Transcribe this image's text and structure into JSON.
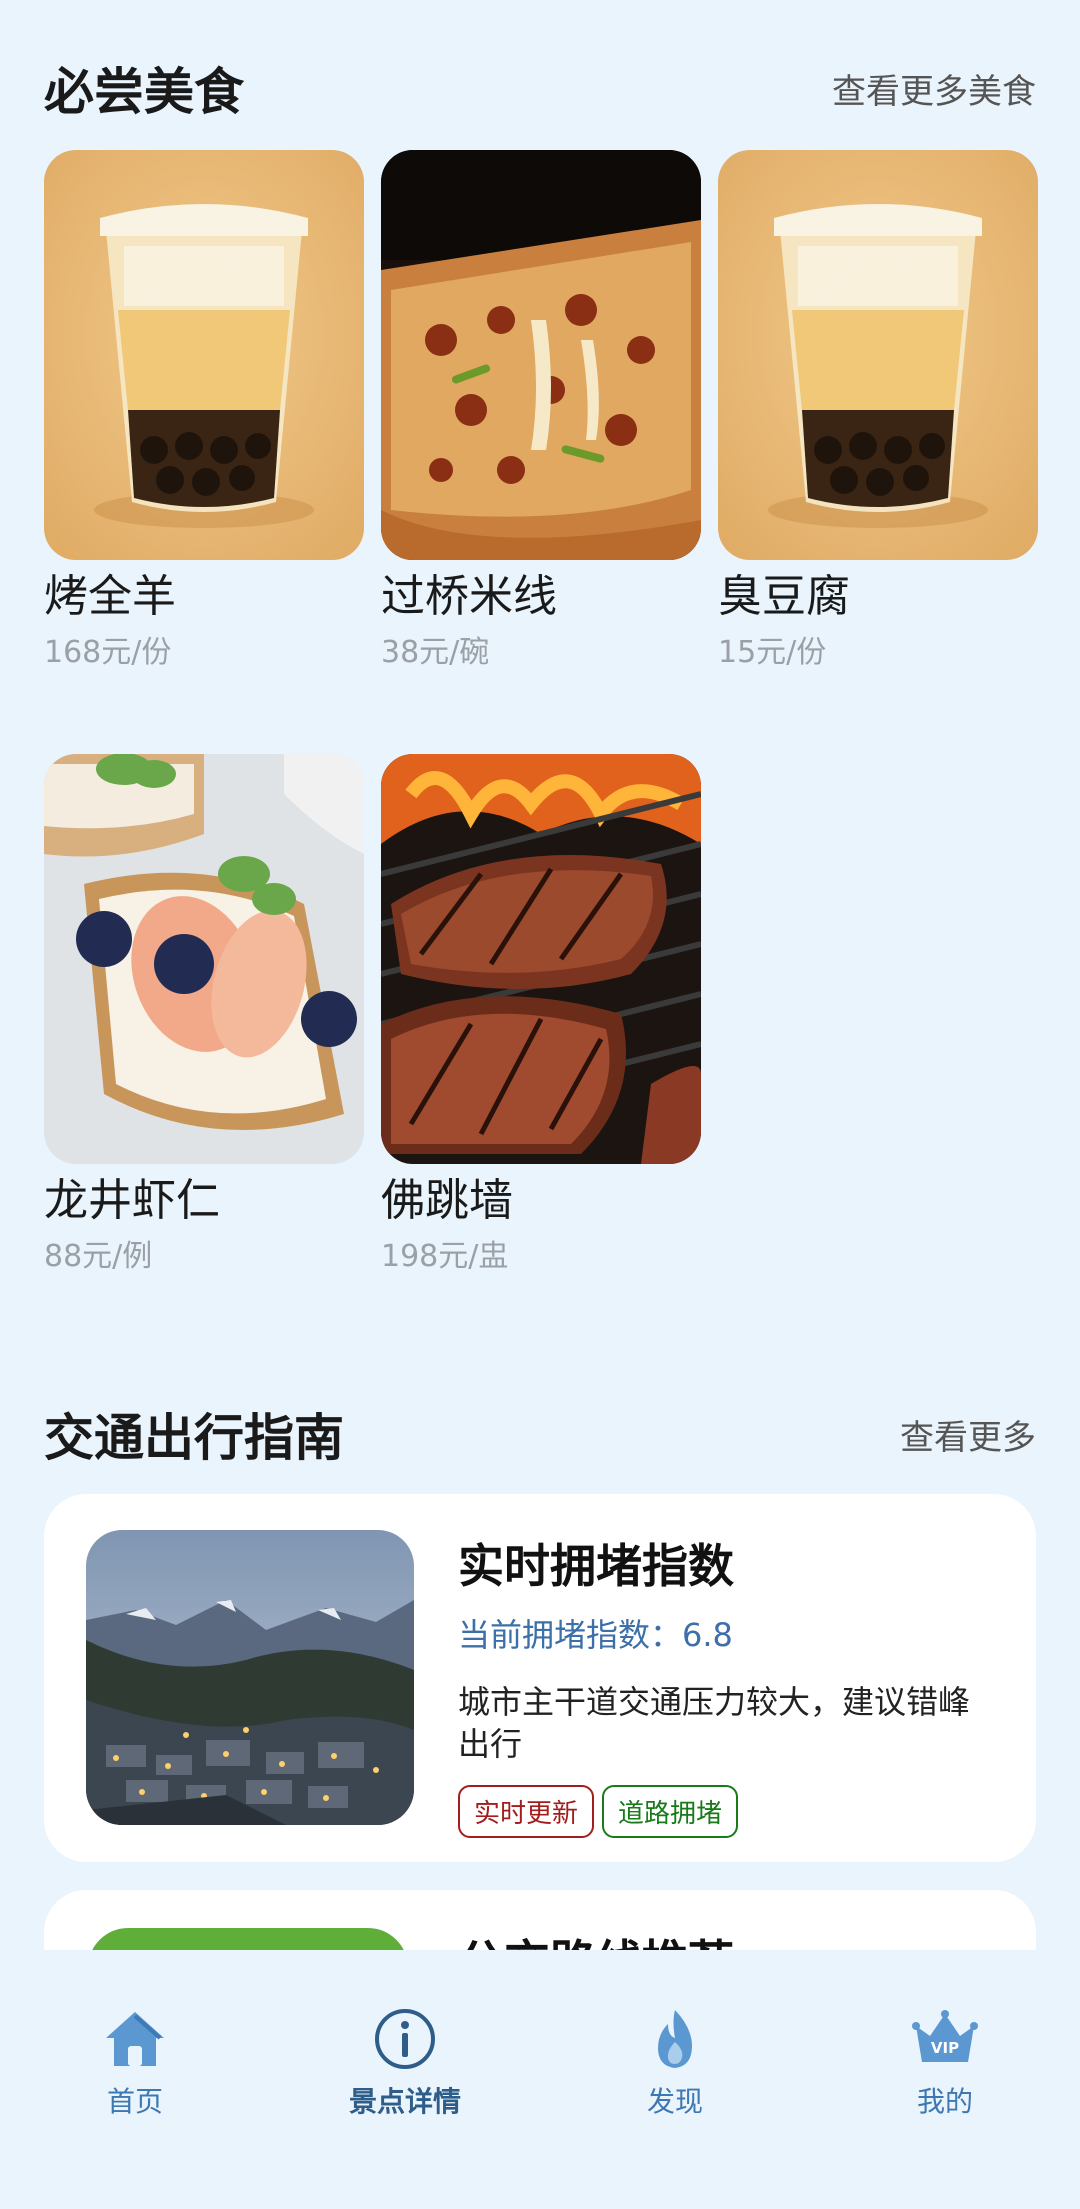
{
  "food_section": {
    "title": "必尝美食",
    "more": "查看更多美食",
    "items": [
      {
        "name": "烤全羊",
        "price": "168元/份",
        "image": "bubble-tea-photo"
      },
      {
        "name": "过桥米线",
        "price": "38元/碗",
        "image": "pizza-photo"
      },
      {
        "name": "臭豆腐",
        "price": "15元/份",
        "image": "bubble-tea-photo"
      },
      {
        "name": "龙井虾仁",
        "price": "88元/例",
        "image": "peach-toast-photo"
      },
      {
        "name": "佛跳墙",
        "price": "198元/盅",
        "image": "grilled-steak-photo"
      }
    ]
  },
  "traffic_section": {
    "title": "交通出行指南",
    "more": "查看更多",
    "cards": [
      {
        "title": "实时拥堵指数",
        "subtitle": "当前拥堵指数：6.8",
        "description": "城市主干道交通压力较大，建议错峰出行",
        "tags": [
          {
            "label": "实时更新",
            "color": "#a31d1d"
          },
          {
            "label": "道路拥堵",
            "color": "#197a19"
          }
        ],
        "image": "mountain-town-photo"
      },
      {
        "title": "公交路线推荐"
      }
    ]
  },
  "nav": {
    "items": [
      {
        "label": "首页",
        "icon": "home-icon"
      },
      {
        "label": "景点详情",
        "icon": "info-icon"
      },
      {
        "label": "发现",
        "icon": "flame-icon"
      },
      {
        "label": "我的",
        "icon": "vip-crown-icon"
      }
    ],
    "active_index": 1,
    "vip_badge": "VIP"
  },
  "colors": {
    "background": "#eaf4fc",
    "accent": "#3e78b2",
    "tag_red": "#a31d1d",
    "tag_green": "#197a19"
  }
}
